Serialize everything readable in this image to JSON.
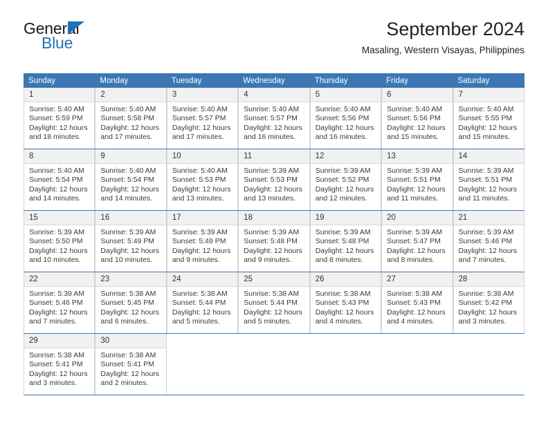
{
  "brand": {
    "name_top": "General",
    "name_bottom": "Blue",
    "triangle_color": "#1e72b8"
  },
  "header": {
    "month_title": "September 2024",
    "location": "Masaling, Western Visayas, Philippines"
  },
  "theme": {
    "header_bg": "#3b77b5",
    "header_text": "#ffffff",
    "daynum_bg": "#f1f1f1",
    "cell_border": "#d4d4d4",
    "row_divider": "#3b77b5"
  },
  "weekday_headers": [
    "Sunday",
    "Monday",
    "Tuesday",
    "Wednesday",
    "Thursday",
    "Friday",
    "Saturday"
  ],
  "weeks": [
    [
      {
        "day": "1",
        "sunrise": "Sunrise: 5:40 AM",
        "sunset": "Sunset: 5:59 PM",
        "daylight_1": "Daylight: 12 hours",
        "daylight_2": "and 18 minutes."
      },
      {
        "day": "2",
        "sunrise": "Sunrise: 5:40 AM",
        "sunset": "Sunset: 5:58 PM",
        "daylight_1": "Daylight: 12 hours",
        "daylight_2": "and 17 minutes."
      },
      {
        "day": "3",
        "sunrise": "Sunrise: 5:40 AM",
        "sunset": "Sunset: 5:57 PM",
        "daylight_1": "Daylight: 12 hours",
        "daylight_2": "and 17 minutes."
      },
      {
        "day": "4",
        "sunrise": "Sunrise: 5:40 AM",
        "sunset": "Sunset: 5:57 PM",
        "daylight_1": "Daylight: 12 hours",
        "daylight_2": "and 16 minutes."
      },
      {
        "day": "5",
        "sunrise": "Sunrise: 5:40 AM",
        "sunset": "Sunset: 5:56 PM",
        "daylight_1": "Daylight: 12 hours",
        "daylight_2": "and 16 minutes."
      },
      {
        "day": "6",
        "sunrise": "Sunrise: 5:40 AM",
        "sunset": "Sunset: 5:56 PM",
        "daylight_1": "Daylight: 12 hours",
        "daylight_2": "and 15 minutes."
      },
      {
        "day": "7",
        "sunrise": "Sunrise: 5:40 AM",
        "sunset": "Sunset: 5:55 PM",
        "daylight_1": "Daylight: 12 hours",
        "daylight_2": "and 15 minutes."
      }
    ],
    [
      {
        "day": "8",
        "sunrise": "Sunrise: 5:40 AM",
        "sunset": "Sunset: 5:54 PM",
        "daylight_1": "Daylight: 12 hours",
        "daylight_2": "and 14 minutes."
      },
      {
        "day": "9",
        "sunrise": "Sunrise: 5:40 AM",
        "sunset": "Sunset: 5:54 PM",
        "daylight_1": "Daylight: 12 hours",
        "daylight_2": "and 14 minutes."
      },
      {
        "day": "10",
        "sunrise": "Sunrise: 5:40 AM",
        "sunset": "Sunset: 5:53 PM",
        "daylight_1": "Daylight: 12 hours",
        "daylight_2": "and 13 minutes."
      },
      {
        "day": "11",
        "sunrise": "Sunrise: 5:39 AM",
        "sunset": "Sunset: 5:53 PM",
        "daylight_1": "Daylight: 12 hours",
        "daylight_2": "and 13 minutes."
      },
      {
        "day": "12",
        "sunrise": "Sunrise: 5:39 AM",
        "sunset": "Sunset: 5:52 PM",
        "daylight_1": "Daylight: 12 hours",
        "daylight_2": "and 12 minutes."
      },
      {
        "day": "13",
        "sunrise": "Sunrise: 5:39 AM",
        "sunset": "Sunset: 5:51 PM",
        "daylight_1": "Daylight: 12 hours",
        "daylight_2": "and 11 minutes."
      },
      {
        "day": "14",
        "sunrise": "Sunrise: 5:39 AM",
        "sunset": "Sunset: 5:51 PM",
        "daylight_1": "Daylight: 12 hours",
        "daylight_2": "and 11 minutes."
      }
    ],
    [
      {
        "day": "15",
        "sunrise": "Sunrise: 5:39 AM",
        "sunset": "Sunset: 5:50 PM",
        "daylight_1": "Daylight: 12 hours",
        "daylight_2": "and 10 minutes."
      },
      {
        "day": "16",
        "sunrise": "Sunrise: 5:39 AM",
        "sunset": "Sunset: 5:49 PM",
        "daylight_1": "Daylight: 12 hours",
        "daylight_2": "and 10 minutes."
      },
      {
        "day": "17",
        "sunrise": "Sunrise: 5:39 AM",
        "sunset": "Sunset: 5:49 PM",
        "daylight_1": "Daylight: 12 hours",
        "daylight_2": "and 9 minutes."
      },
      {
        "day": "18",
        "sunrise": "Sunrise: 5:39 AM",
        "sunset": "Sunset: 5:48 PM",
        "daylight_1": "Daylight: 12 hours",
        "daylight_2": "and 9 minutes."
      },
      {
        "day": "19",
        "sunrise": "Sunrise: 5:39 AM",
        "sunset": "Sunset: 5:48 PM",
        "daylight_1": "Daylight: 12 hours",
        "daylight_2": "and 8 minutes."
      },
      {
        "day": "20",
        "sunrise": "Sunrise: 5:39 AM",
        "sunset": "Sunset: 5:47 PM",
        "daylight_1": "Daylight: 12 hours",
        "daylight_2": "and 8 minutes."
      },
      {
        "day": "21",
        "sunrise": "Sunrise: 5:39 AM",
        "sunset": "Sunset: 5:46 PM",
        "daylight_1": "Daylight: 12 hours",
        "daylight_2": "and 7 minutes."
      }
    ],
    [
      {
        "day": "22",
        "sunrise": "Sunrise: 5:39 AM",
        "sunset": "Sunset: 5:46 PM",
        "daylight_1": "Daylight: 12 hours",
        "daylight_2": "and 7 minutes."
      },
      {
        "day": "23",
        "sunrise": "Sunrise: 5:38 AM",
        "sunset": "Sunset: 5:45 PM",
        "daylight_1": "Daylight: 12 hours",
        "daylight_2": "and 6 minutes."
      },
      {
        "day": "24",
        "sunrise": "Sunrise: 5:38 AM",
        "sunset": "Sunset: 5:44 PM",
        "daylight_1": "Daylight: 12 hours",
        "daylight_2": "and 5 minutes."
      },
      {
        "day": "25",
        "sunrise": "Sunrise: 5:38 AM",
        "sunset": "Sunset: 5:44 PM",
        "daylight_1": "Daylight: 12 hours",
        "daylight_2": "and 5 minutes."
      },
      {
        "day": "26",
        "sunrise": "Sunrise: 5:38 AM",
        "sunset": "Sunset: 5:43 PM",
        "daylight_1": "Daylight: 12 hours",
        "daylight_2": "and 4 minutes."
      },
      {
        "day": "27",
        "sunrise": "Sunrise: 5:38 AM",
        "sunset": "Sunset: 5:43 PM",
        "daylight_1": "Daylight: 12 hours",
        "daylight_2": "and 4 minutes."
      },
      {
        "day": "28",
        "sunrise": "Sunrise: 5:38 AM",
        "sunset": "Sunset: 5:42 PM",
        "daylight_1": "Daylight: 12 hours",
        "daylight_2": "and 3 minutes."
      }
    ],
    [
      {
        "day": "29",
        "sunrise": "Sunrise: 5:38 AM",
        "sunset": "Sunset: 5:41 PM",
        "daylight_1": "Daylight: 12 hours",
        "daylight_2": "and 3 minutes."
      },
      {
        "day": "30",
        "sunrise": "Sunrise: 5:38 AM",
        "sunset": "Sunset: 5:41 PM",
        "daylight_1": "Daylight: 12 hours",
        "daylight_2": "and 2 minutes."
      },
      {
        "day": "",
        "sunrise": "",
        "sunset": "",
        "daylight_1": "",
        "daylight_2": ""
      },
      {
        "day": "",
        "sunrise": "",
        "sunset": "",
        "daylight_1": "",
        "daylight_2": ""
      },
      {
        "day": "",
        "sunrise": "",
        "sunset": "",
        "daylight_1": "",
        "daylight_2": ""
      },
      {
        "day": "",
        "sunrise": "",
        "sunset": "",
        "daylight_1": "",
        "daylight_2": ""
      },
      {
        "day": "",
        "sunrise": "",
        "sunset": "",
        "daylight_1": "",
        "daylight_2": ""
      }
    ]
  ]
}
